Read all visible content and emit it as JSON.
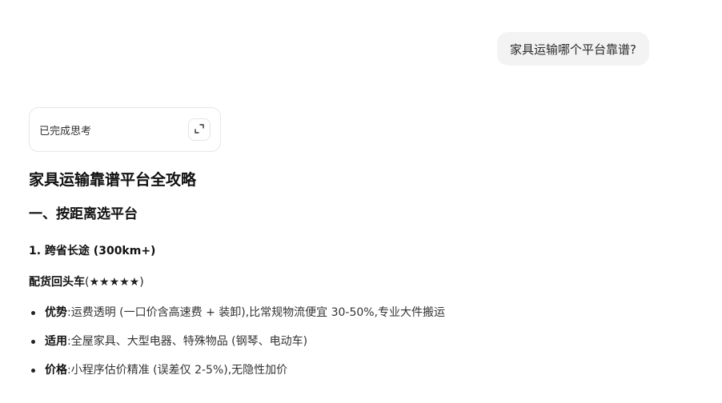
{
  "user_message": "家具运输哪个平台靠谱?",
  "thinking": {
    "label": "已完成思考",
    "expand_icon": "expand-icon"
  },
  "answer": {
    "title": "家具运输靠谱平台全攻略",
    "section1": {
      "heading": "一、按距离选平台",
      "sub1": {
        "heading": "1. 跨省长途 (300km+)",
        "option_name": "配货回头车",
        "option_rating": "(★★★★★)",
        "points": [
          {
            "term": "优势",
            "sep": ":",
            "text": "运费透明 (一口价含高速费 + 装卸),比常规物流便宜 30-50%,专业大件搬运"
          },
          {
            "term": "适用",
            "sep": ":",
            "text": "全屋家具、大型电器、特殊物品 (钢琴、电动车)"
          },
          {
            "term": "价格",
            "sep": ":",
            "text": "小程序估价精准 (误差仅 2-5%),无隐性加价"
          }
        ]
      }
    }
  }
}
